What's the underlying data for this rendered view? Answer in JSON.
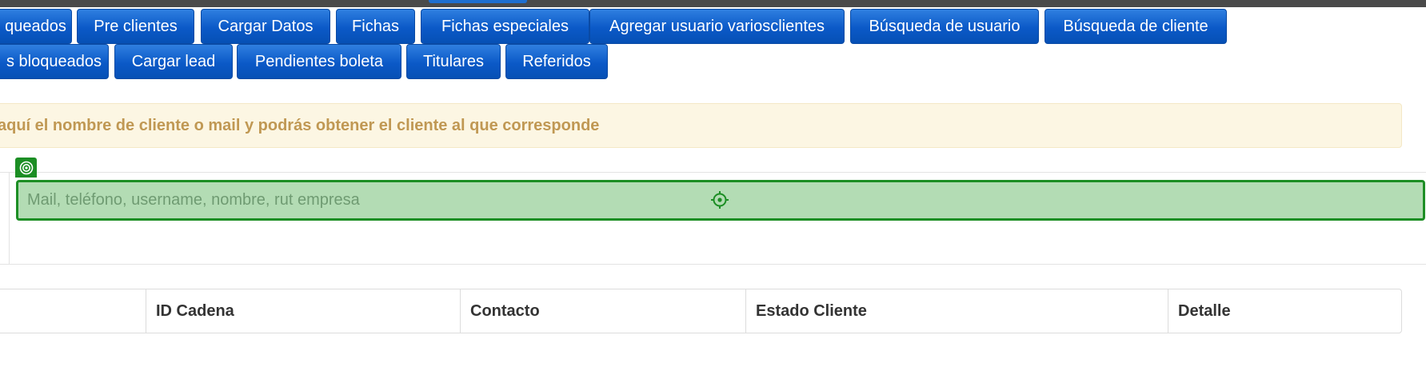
{
  "nav": {
    "row1": [
      "queados",
      "Pre clientes",
      "Cargar Datos",
      "Fichas",
      "Fichas especiales",
      "Agregar usuario variosclientes",
      "Búsqueda de usuario",
      "Búsqueda de cliente"
    ],
    "row2": [
      "s bloqueados",
      "Cargar lead",
      "Pendientes boleta",
      "Titulares",
      "Referidos"
    ]
  },
  "alert": {
    "text": "aquí el nombre de cliente o mail y podrás obtener el cliente al que corresponde"
  },
  "search": {
    "placeholder": "Mail, teléfono, username, nombre, rut empresa",
    "value": ""
  },
  "table": {
    "headers": [
      "ID Cadena",
      "Contacto",
      "Estado Cliente",
      "Detalle"
    ]
  },
  "colors": {
    "button_blue": "#0b59c7",
    "alert_text": "#c09853",
    "alert_bg": "#fcf6e3",
    "highlight_green": "#1c8e24",
    "highlight_fill": "#b3dcb4"
  },
  "icons": [
    "target-icon",
    "crosshair-icon"
  ]
}
